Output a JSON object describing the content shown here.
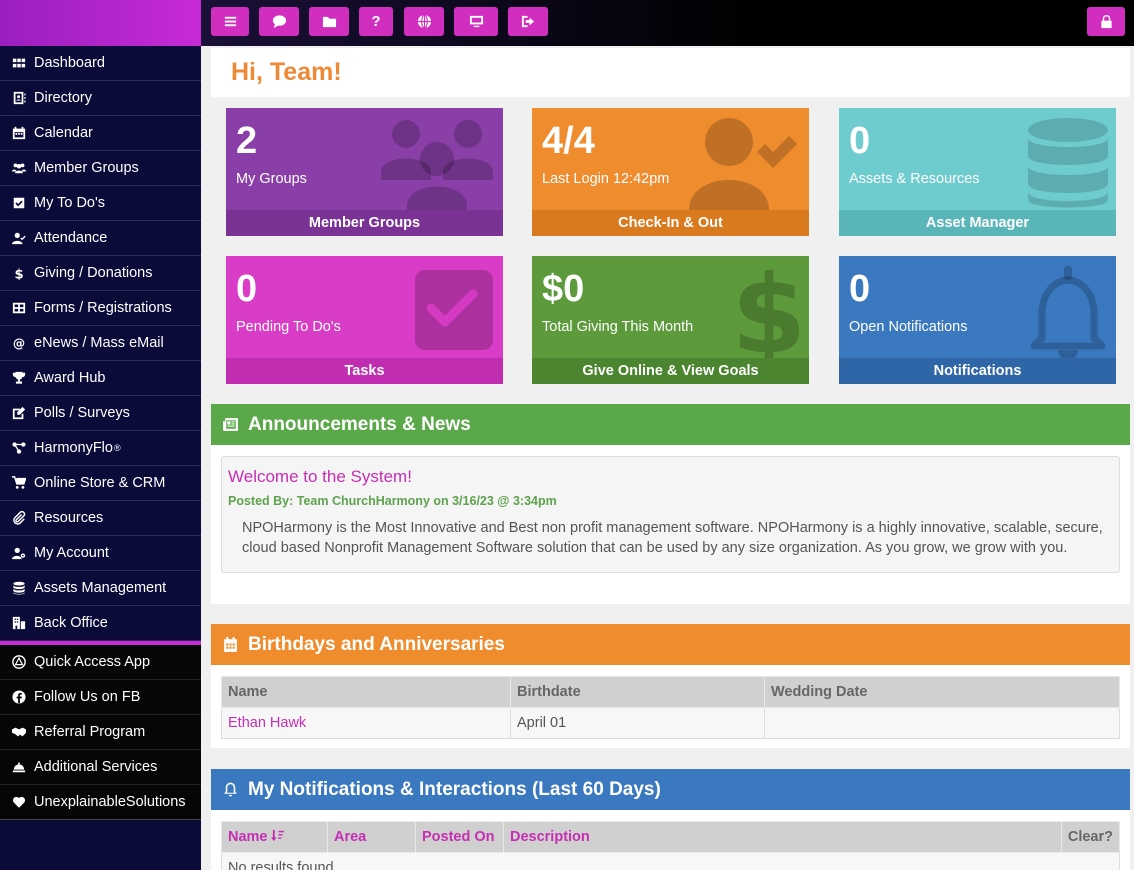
{
  "sidebar": {
    "items": [
      {
        "label": "Dashboard",
        "icon": "grid-icon"
      },
      {
        "label": "Directory",
        "icon": "contact-book-icon"
      },
      {
        "label": "Calendar",
        "icon": "calendar-icon"
      },
      {
        "label": "Member Groups",
        "icon": "users-icon"
      },
      {
        "label": "My To Do's",
        "icon": "checkbox-icon"
      },
      {
        "label": "Attendance",
        "icon": "user-check-icon"
      },
      {
        "label": "Giving / Donations",
        "icon": "dollar-icon"
      },
      {
        "label": "Forms / Registrations",
        "icon": "form-icon"
      },
      {
        "label": "eNews / Mass eMail",
        "icon": "at-icon"
      },
      {
        "label": "Award Hub",
        "icon": "trophy-icon"
      },
      {
        "label": "Polls / Surveys",
        "icon": "edit-icon"
      },
      {
        "label": "HarmonyFlo",
        "sup": "®",
        "icon": "flow-icon"
      },
      {
        "label": "Online Store & CRM",
        "icon": "cart-icon"
      },
      {
        "label": "Resources",
        "icon": "paperclip-icon"
      },
      {
        "label": "My Account",
        "icon": "user-gear-icon"
      },
      {
        "label": "Assets Management",
        "icon": "database-icon"
      },
      {
        "label": "Back Office",
        "icon": "building-icon"
      }
    ],
    "secondary": [
      {
        "label": "Quick Access App",
        "icon": "app-icon"
      },
      {
        "label": "Follow Us on FB",
        "icon": "facebook-icon"
      },
      {
        "label": "Referral Program",
        "icon": "handshake-icon"
      },
      {
        "label": "Additional Services",
        "icon": "bell-service-icon"
      },
      {
        "label": "UnexplainableSolutions",
        "icon": "heart-icon"
      }
    ]
  },
  "topbar": {
    "buttons": [
      "menu-icon",
      "chat-icon",
      "folder-icon",
      "help-icon",
      "globe-icon",
      "monitor-icon",
      "logout-icon"
    ],
    "help_label": "?",
    "right_button": "lock-icon"
  },
  "greeting": "Hi, Team!",
  "tiles": [
    {
      "value": "2",
      "label": "My Groups",
      "footer": "Member Groups",
      "color": "#8a3fa8",
      "footer_color": "#7a3295"
    },
    {
      "value": "4/4",
      "label": "Last Login 12:42pm",
      "footer": "Check-In & Out",
      "color": "#ef8c2e",
      "footer_color": "#d97a1f"
    },
    {
      "value": "0",
      "label": "Assets & Resources",
      "footer": "Asset Manager",
      "color": "#6ecccf",
      "footer_color": "#5ab5b9"
    },
    {
      "value": "0",
      "label": "Pending To Do's",
      "footer": "Tasks",
      "color": "#d93cc7",
      "footer_color": "#c02db0"
    },
    {
      "value": "$0",
      "label": "Total Giving This Month",
      "footer": "Give Online & View Goals",
      "color": "#5d9a3b",
      "footer_color": "#4c8530"
    },
    {
      "value": "0",
      "label": "Open Notifications",
      "footer": "Notifications",
      "color": "#3a78c0",
      "footer_color": "#2e66a8"
    }
  ],
  "announcements": {
    "title": "Announcements & News",
    "color": "#5ba84a",
    "post_title": "Welcome to the System!",
    "posted_by": "Posted By: Team ChurchHarmony on 3/16/23 @ 3:34pm",
    "body": "NPOHarmony is the Most Innovative and Best non profit management software. NPOHarmony is a highly innovative, scalable, secure, cloud based Nonprofit Management Software solution that can be used by any size organization. As you grow, we grow with you."
  },
  "birthdays": {
    "title": "Birthdays and Anniversaries",
    "color": "#ef8c2e",
    "columns": [
      "Name",
      "Birthdate",
      "Wedding Date"
    ],
    "rows": [
      {
        "name": "Ethan Hawk",
        "birthdate": "April 01",
        "wedding": ""
      }
    ]
  },
  "notifications": {
    "title": "My Notifications & Interactions (Last 60 Days)",
    "color": "#3a78c0",
    "columns": [
      "Name",
      "Area",
      "Posted On",
      "Description",
      "Clear?"
    ],
    "empty_text": "No results found."
  }
}
